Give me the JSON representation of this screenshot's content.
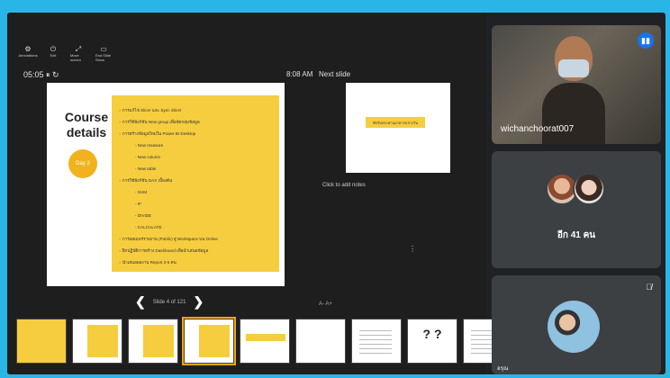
{
  "toolbar": {
    "items": [
      {
        "label": "Annotations",
        "icon": "gear-icon"
      },
      {
        "label": "Exit",
        "icon": "exit-icon"
      },
      {
        "label": "Move screen",
        "icon": "swap-icon"
      },
      {
        "label": "End Slide Show",
        "icon": "end-show-icon"
      }
    ]
  },
  "presenter": {
    "timer": "05:05 ⏸ ↻",
    "clock": "8:08 AM",
    "next_label": "Next slide",
    "notes_placeholder": "Click to add notes",
    "font_controls": "A-  A+",
    "slide_counter": "Slide 4 of 121"
  },
  "slide": {
    "title": "Course details",
    "badge": "Day 2",
    "bullets": [
      {
        "text": "การแก้ไข Slicer และ Sync Slicer",
        "sub": false
      },
      {
        "text": "การใช้ฟังก์ชัน New group เพื่อจัดกลุ่มข้อมูล",
        "sub": false
      },
      {
        "text": "การสร้างข้อมูลใหม่ใน Power BI Desktop",
        "sub": false
      },
      {
        "text": "- New measure",
        "sub": true
      },
      {
        "text": "- New column",
        "sub": true
      },
      {
        "text": "- New table",
        "sub": true
      },
      {
        "text": "การใช้ฟังก์ชัน DAX เบื้องต้น",
        "sub": false
      },
      {
        "text": "- SUM",
        "sub": true
      },
      {
        "text": "- IF",
        "sub": true
      },
      {
        "text": "- DIVIDE",
        "sub": true
      },
      {
        "text": "- CALCULATE",
        "sub": true
      },
      {
        "text": "การเผยแพร่รายงาน (Public) สู่ Workspace บน Online",
        "sub": false
      },
      {
        "text": "ฝึกปฏิบัติการสร้าง Dashboard เพื่อนำเสนอข้อมูล",
        "sub": false
      },
      {
        "text": "นำเสนอผลงาน Report 3-5 คน",
        "sub": false
      }
    ]
  },
  "next_slide": {
    "chip_text": "พักรับประทานอาหารกลางวัน"
  },
  "filmstrip": [
    {
      "style": "yellow"
    },
    {
      "style": "white-panel"
    },
    {
      "style": "white-panel"
    },
    {
      "style": "white-panel-selected"
    },
    {
      "style": "white-chip"
    },
    {
      "style": "white"
    },
    {
      "style": "white-lines"
    },
    {
      "style": "question"
    },
    {
      "style": "white-lines"
    }
  ],
  "participants": {
    "main_name": "wichanchoorat007",
    "others_label": "อีก 41 คน",
    "third_name": "อรุณ"
  },
  "colors": {
    "background": "#29b6e6",
    "slide_accent": "#f6cd3f",
    "badge": "#f2b21c",
    "speaking": "#1a73e8"
  }
}
